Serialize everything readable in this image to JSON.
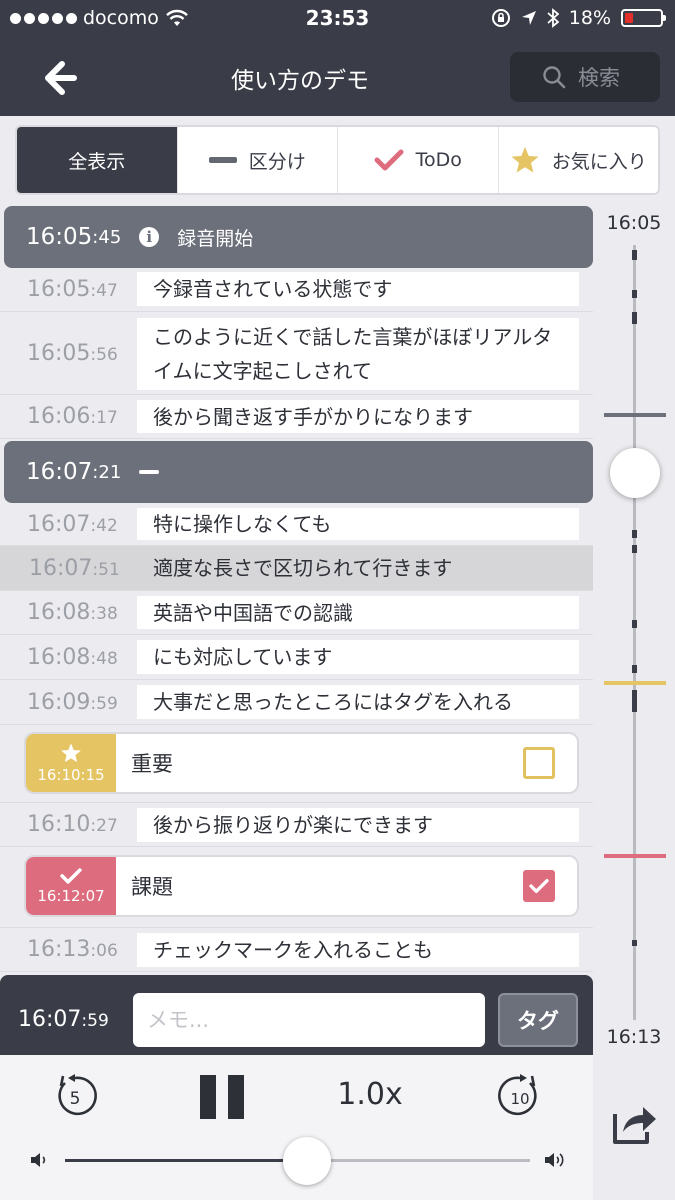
{
  "status_bar": {
    "carrier": "docomo",
    "time": "23:53",
    "battery": "18%"
  },
  "nav": {
    "title": "使い方のデモ",
    "search_placeholder": "検索"
  },
  "filters": [
    {
      "label": "全表示"
    },
    {
      "label": "区分け"
    },
    {
      "label": "ToDo"
    },
    {
      "label": "お気に入り"
    }
  ],
  "sections": [
    {
      "time_main": "16:05",
      "time_sec": ":45",
      "label": "録音開始"
    },
    {
      "time_main": "16:07",
      "time_sec": ":21"
    }
  ],
  "rows": [
    {
      "time_main": "16:05",
      "time_sec": ":47",
      "text": "今録音されている状態です"
    },
    {
      "time_main": "16:05",
      "time_sec": ":56",
      "text": "このように近くで話した言葉がほぼリアルタイムに文字起こしされて"
    },
    {
      "time_main": "16:06",
      "time_sec": ":17",
      "text": "後から聞き返す手がかりになります"
    },
    {
      "time_main": "16:07",
      "time_sec": ":42",
      "text": "特に操作しなくても"
    },
    {
      "time_main": "16:07",
      "time_sec": ":51",
      "text": "適度な長さで区切られて行きます"
    },
    {
      "time_main": "16:08",
      "time_sec": ":38",
      "text": "英語や中国語での認識"
    },
    {
      "time_main": "16:08",
      "time_sec": ":48",
      "text": "にも対応しています"
    },
    {
      "time_main": "16:09",
      "time_sec": ":59",
      "text": "大事だと思ったところにはタグを入れる"
    },
    {
      "time_main": "16:10",
      "time_sec": ":27",
      "text": "後から振り返りが楽にできます"
    },
    {
      "time_main": "16:13",
      "time_sec": ":06",
      "text": "チェックマークを入れることも"
    }
  ],
  "tags": [
    {
      "time": "16:10:15",
      "label": "重要",
      "checked": false,
      "color": "#e5c463"
    },
    {
      "time": "16:12:07",
      "label": "課題",
      "checked": true,
      "color": "#dd6c7e"
    }
  ],
  "memo": {
    "time_main": "16:07",
    "time_sec": ":59",
    "placeholder": "メモ...",
    "tag_button": "タグ"
  },
  "player": {
    "speed": "1.0x",
    "rewind_seconds": "5",
    "forward_seconds": "10",
    "progress": 0.52
  },
  "timeline": {
    "start": "16:05",
    "end": "16:13"
  },
  "colors": {
    "dark": "#3a3d47",
    "favorite": "#e5c463",
    "todo": "#dd6c7e"
  }
}
